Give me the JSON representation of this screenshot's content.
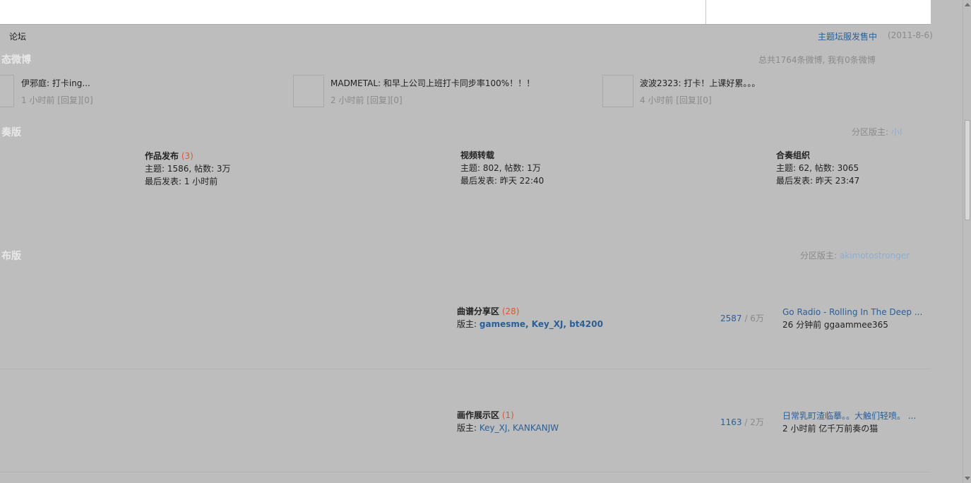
{
  "breadcrumb": {
    "label": "论坛"
  },
  "announcement": {
    "text": "主题坛服发售中",
    "date": "(2011-8-6)"
  },
  "weibo": {
    "title": "态微博",
    "stats": "总共1764条微博, 我有0条微博",
    "items": [
      {
        "text": "伊邪庭: 打卡ing...",
        "meta": "1 小时前 [回复][0]"
      },
      {
        "text": "MADMETAL: 和早上公司上班打卡同步率100%！！！",
        "meta": "2 小时前 [回复][0]"
      },
      {
        "text": "波波2323: 打卡！上课好累。。。",
        "meta": "4 小时前 [回复][0]"
      }
    ]
  },
  "ensemble": {
    "title": "奏版",
    "mod_label": "分区版主:",
    "mod_name": "小I",
    "forums": [
      {
        "name": "作品发布",
        "new_count": "(3)",
        "stats": "主题: 1586, 帖数: 3万",
        "last": "最后发表: 1 小时前"
      },
      {
        "name": "视频转载",
        "new_count": "",
        "stats": "主题: 802, 帖数: 1万",
        "last": "最后发表: 昨天 22:40"
      },
      {
        "name": "合奏组织",
        "new_count": "",
        "stats": "主题: 62, 帖数: 3065",
        "last": "最后发表: 昨天 23:47"
      }
    ]
  },
  "release": {
    "title": "布版",
    "mod_label": "分区版主:",
    "mod_name": "akimotostronger",
    "forums": [
      {
        "name": "曲谱分享区",
        "new_count": "(28)",
        "mods_label": "版主:",
        "mods": "gamesme, Key_XJ, bt4200",
        "topics": "2587",
        "posts": "/ 6万",
        "last_title": "Go Radio - Rolling In The Deep ...",
        "last_meta": "26 分钟前  ggaammee365"
      },
      {
        "name": "画作展示区",
        "new_count": "(1)",
        "mods_label": "版主:",
        "mods": "Key_XJ, KANKANJW",
        "topics": "1163",
        "posts": "/ 2万",
        "last_title": "日常乳町渣临摹。。大触们轻喷。 ...",
        "last_meta": "2 小时前  亿千万前奏の猫"
      }
    ]
  }
}
